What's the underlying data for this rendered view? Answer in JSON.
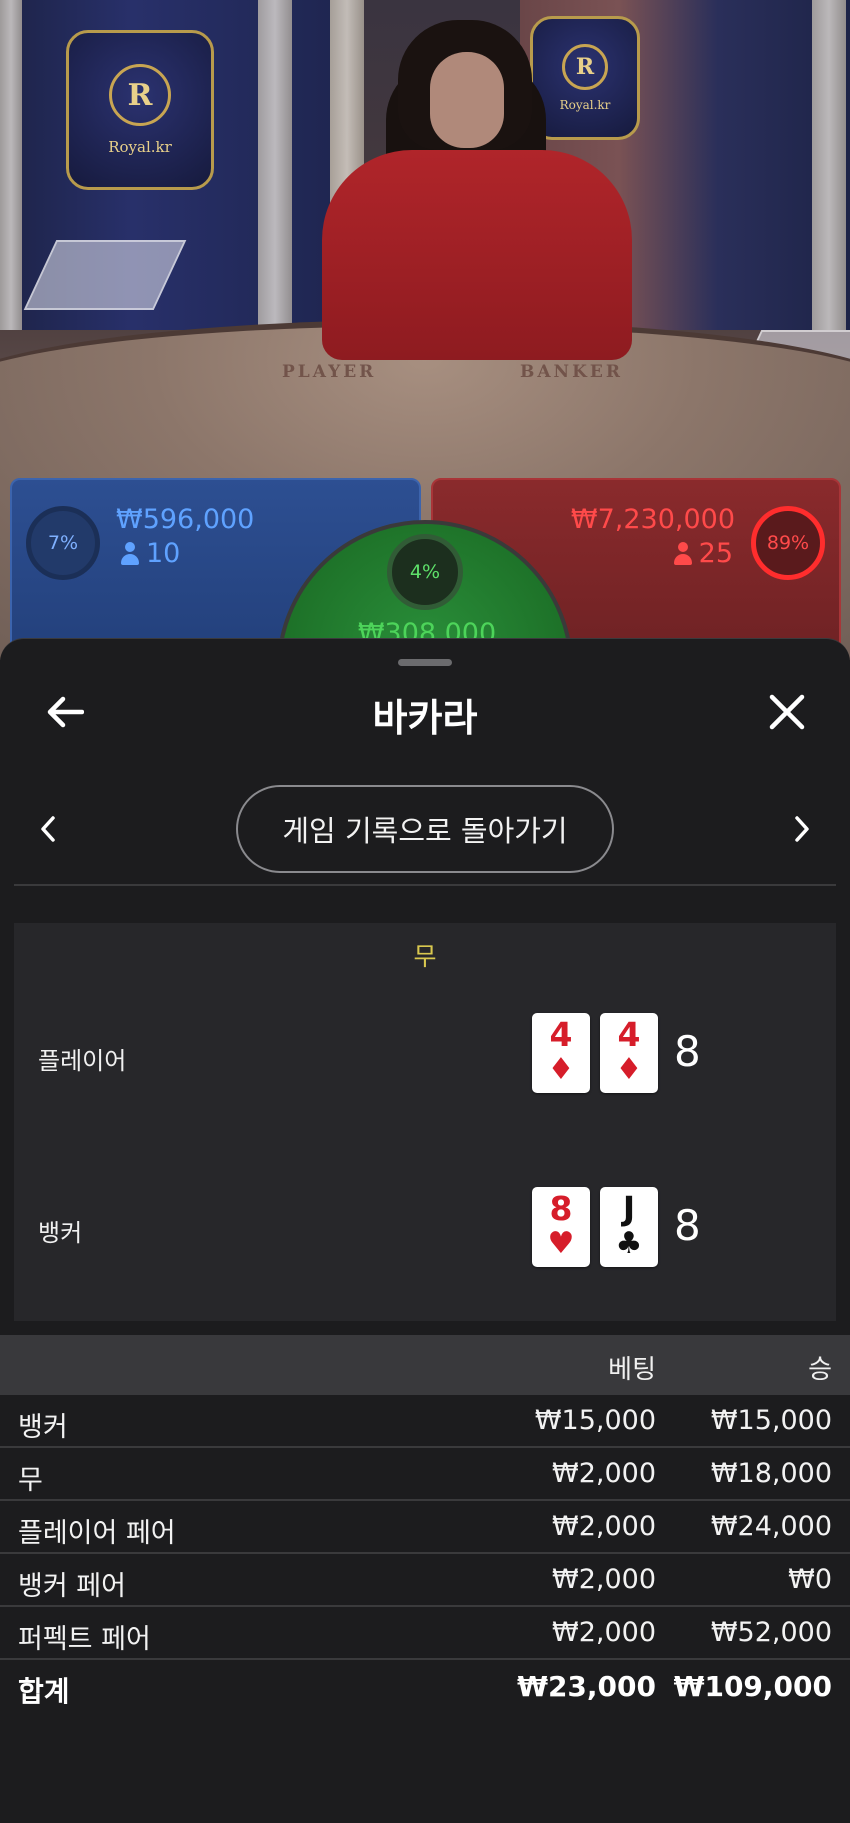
{
  "colors": {
    "player": "#2d4f92",
    "banker": "#8a2a2c",
    "tie": "#2a8f3a",
    "sheet_bg": "#1c1c1e",
    "tie_text": "#d9c84f"
  },
  "stream": {
    "plaque_left": "Royal.kr",
    "plaque_right": "Royal.kr",
    "plaque_monogram": "R",
    "felt_player": "PLAYER",
    "felt_banker": "BANKER"
  },
  "bets": {
    "player": {
      "percent": "7%",
      "percent_value": 7,
      "amount": "₩596,000",
      "count": "10"
    },
    "tie": {
      "percent": "4%",
      "percent_value": 4,
      "amount": "₩308,000"
    },
    "banker": {
      "percent": "89%",
      "percent_value": 89,
      "amount": "₩7,230,000",
      "count": "25"
    }
  },
  "sheet": {
    "title": "바카라",
    "back_icon": "arrow-left-icon",
    "close_icon": "close-icon",
    "history_button": "게임 기록으로 돌아가기",
    "prev_icon": "chevron-left-icon",
    "next_icon": "chevron-right-icon"
  },
  "result": {
    "outcome": "무",
    "player": {
      "label": "플레이어",
      "total": "8",
      "cards": [
        {
          "rank": "4",
          "suit": "♦",
          "color": "red"
        },
        {
          "rank": "4",
          "suit": "♦",
          "color": "red"
        }
      ]
    },
    "banker": {
      "label": "뱅커",
      "total": "8",
      "cards": [
        {
          "rank": "8",
          "suit": "♥",
          "color": "red"
        },
        {
          "rank": "J",
          "suit": "♣",
          "color": "black"
        }
      ]
    }
  },
  "bet_table": {
    "headers": {
      "bet": "베팅",
      "win": "승"
    },
    "rows": [
      {
        "name": "뱅커",
        "bet": "₩15,000",
        "win": "₩15,000"
      },
      {
        "name": "무",
        "bet": "₩2,000",
        "win": "₩18,000"
      },
      {
        "name": "플레이어 페어",
        "bet": "₩2,000",
        "win": "₩24,000"
      },
      {
        "name": "뱅커 페어",
        "bet": "₩2,000",
        "win": "₩0"
      },
      {
        "name": "퍼펙트 페어",
        "bet": "₩2,000",
        "win": "₩52,000"
      }
    ],
    "total": {
      "name": "합계",
      "bet": "₩23,000",
      "win": "₩109,000"
    }
  }
}
